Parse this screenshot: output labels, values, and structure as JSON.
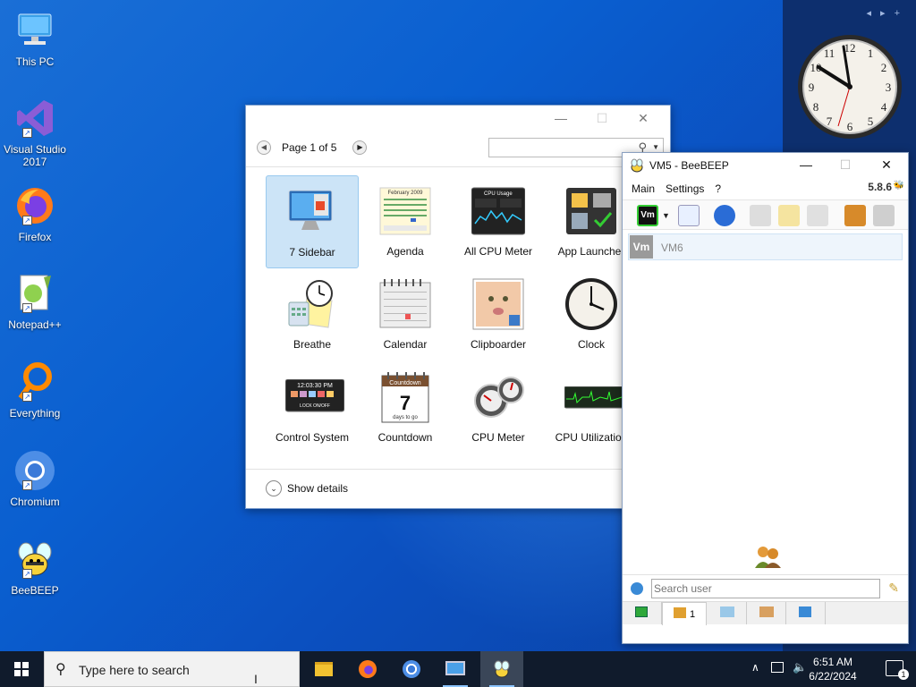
{
  "desktop": {
    "icons": [
      {
        "label": "This PC",
        "icon": "computer-icon"
      },
      {
        "label": "Visual Studio 2017",
        "icon": "visual-studio-icon"
      },
      {
        "label": "Firefox",
        "icon": "firefox-icon"
      },
      {
        "label": "Notepad++",
        "icon": "notepadpp-icon"
      },
      {
        "label": "Everything",
        "icon": "search-magnifier-icon"
      },
      {
        "label": "Chromium",
        "icon": "chromium-icon"
      },
      {
        "label": "BeeBEEP",
        "icon": "bee-icon"
      }
    ]
  },
  "gallery": {
    "page_label": "Page 1 of 5",
    "search_value": "",
    "show_details": "Show details",
    "gadgets": [
      {
        "label": "7 Sidebar",
        "selected": true
      },
      {
        "label": "Agenda"
      },
      {
        "label": "All CPU Meter"
      },
      {
        "label": "App Launcher"
      },
      {
        "label": "Breathe"
      },
      {
        "label": "Calendar"
      },
      {
        "label": "Clipboarder"
      },
      {
        "label": "Clock"
      },
      {
        "label": "Control System"
      },
      {
        "label": "Countdown"
      },
      {
        "label": "CPU Meter"
      },
      {
        "label": "CPU Utilization"
      }
    ],
    "agenda_header": "February 2009",
    "countdown_title": "Countdown",
    "countdown_number": "7",
    "countdown_sub": "days to go",
    "control_time": "12:03:30 PM",
    "control_lock": "LOCK ON/OFF",
    "cpu_usage_title": "CPU Usage"
  },
  "beebeep": {
    "title": "VM5 - BeeBEEP",
    "menu": [
      "Main",
      "Settings",
      "?"
    ],
    "version": "5.8.6",
    "user_avatar": "Vm",
    "user_name": "VM6",
    "search_placeholder": "Search user",
    "tab_count": "1"
  },
  "taskbar": {
    "search_placeholder": "Type here to search",
    "time": "6:51 AM",
    "date": "6/22/2024",
    "notification_count": "1"
  },
  "colors": {
    "accent": "#0078d7",
    "taskbar": "#101b2c",
    "selection": "#cce4f7"
  }
}
